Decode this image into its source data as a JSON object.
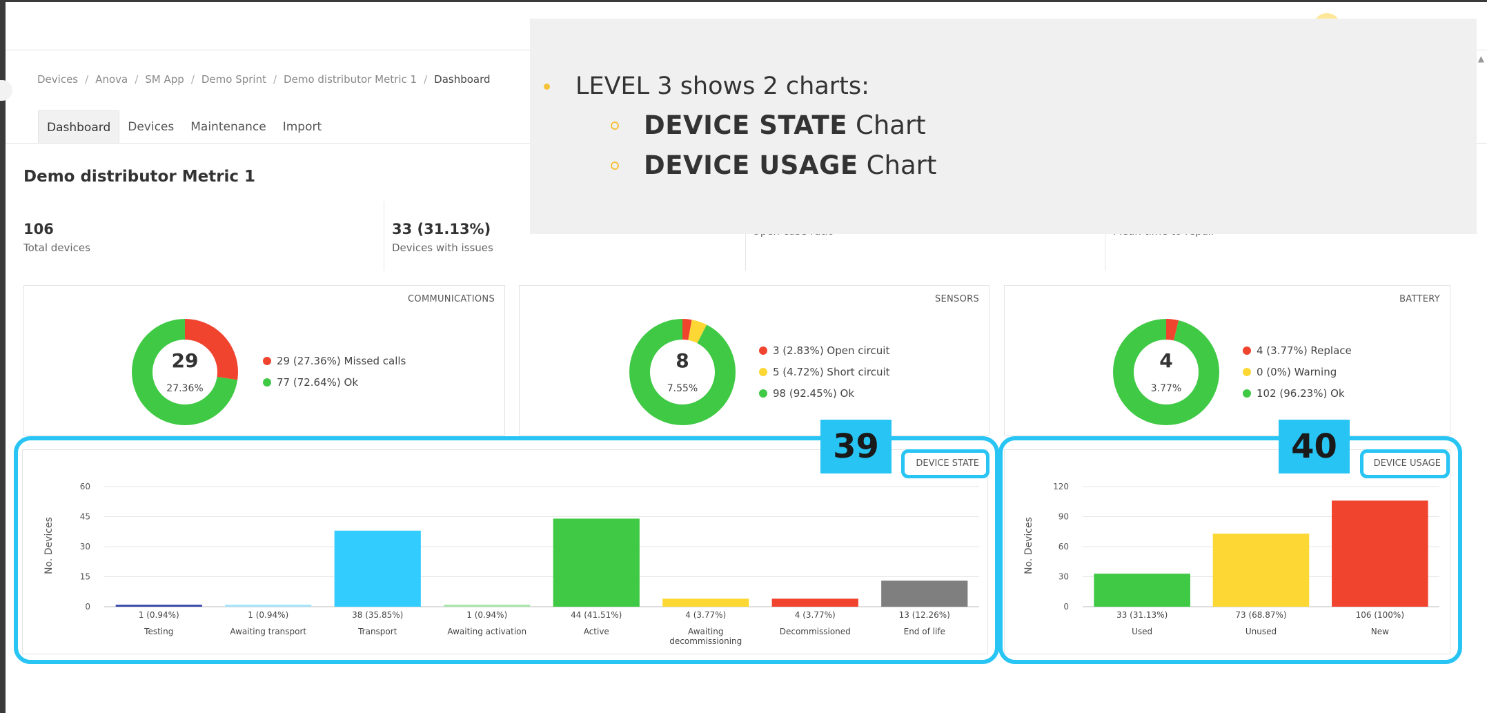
{
  "breadcrumb": [
    "Devices",
    "Anova",
    "SM App",
    "Demo Sprint",
    "Demo distributor Metric 1",
    "Dashboard"
  ],
  "tabs": [
    "Dashboard",
    "Devices",
    "Maintenance",
    "Import"
  ],
  "page_title": "Demo distributor Metric 1",
  "kpis": [
    {
      "value": "106",
      "label": "Total devices"
    },
    {
      "value": "33 (31.13%)",
      "label": "Devices with issues"
    },
    {
      "value": "",
      "label": "Open case ratio"
    },
    {
      "value": "",
      "label": "Mean time to repair"
    }
  ],
  "colors": {
    "red": "#f0442f",
    "green": "#3fc944",
    "yellow": "#fdd835",
    "blue": "#33ccff",
    "highlight": "#27c4f4"
  },
  "donuts": [
    {
      "title": "COMMUNICATIONS",
      "center_value": "29",
      "center_percent": "27.36%",
      "legend": [
        {
          "text": "29 (27.36%) Missed calls",
          "color": "#f0442f",
          "value": 29
        },
        {
          "text": "77 (72.64%) Ok",
          "color": "#3fc944",
          "value": 77
        }
      ]
    },
    {
      "title": "SENSORS",
      "center_value": "8",
      "center_percent": "7.55%",
      "legend": [
        {
          "text": "3 (2.83%) Open circuit",
          "color": "#f0442f",
          "value": 3
        },
        {
          "text": "5 (4.72%) Short circuit",
          "color": "#fdd835",
          "value": 5
        },
        {
          "text": "98 (92.45%) Ok",
          "color": "#3fc944",
          "value": 98
        }
      ]
    },
    {
      "title": "BATTERY",
      "center_value": "4",
      "center_percent": "3.77%",
      "legend": [
        {
          "text": "4 (3.77%) Replace",
          "color": "#f0442f",
          "value": 4
        },
        {
          "text": "0 (0%) Warning",
          "color": "#fdd835",
          "value": 0
        },
        {
          "text": "102 (96.23%) Ok",
          "color": "#3fc944",
          "value": 102
        }
      ]
    }
  ],
  "chart_data": [
    {
      "type": "bar",
      "title": "DEVICE STATE",
      "ylabel": "No. Devices",
      "ylim": [
        0,
        60
      ],
      "yticks": [
        0,
        15,
        30,
        45,
        60
      ],
      "grid": true,
      "categories": [
        "Testing",
        "Awaiting transport",
        "Transport",
        "Awaiting activation",
        "Active",
        "Awaiting decommissioning",
        "Decommissioned",
        "End of life"
      ],
      "values": [
        1,
        1,
        38,
        1,
        44,
        4,
        4,
        13
      ],
      "data_labels": [
        "1 (0.94%)",
        "1 (0.94%)",
        "38 (35.85%)",
        "1 (0.94%)",
        "44 (41.51%)",
        "4 (3.77%)",
        "4 (3.77%)",
        "13 (12.26%)"
      ],
      "colors": [
        "#3949ab",
        "#a4e4fb",
        "#33ccff",
        "#a8e6aa",
        "#3fc944",
        "#fdd835",
        "#f0442f",
        "#7f7f7f"
      ]
    },
    {
      "type": "bar",
      "title": "DEVICE USAGE",
      "ylabel": "No. Devices",
      "ylim": [
        0,
        120
      ],
      "yticks": [
        0,
        30,
        60,
        90,
        120
      ],
      "grid": true,
      "categories": [
        "Used",
        "Unused",
        "New"
      ],
      "values": [
        33,
        73,
        106
      ],
      "data_labels": [
        "33 (31.13%)",
        "73 (68.87%)",
        "106 (100%)"
      ],
      "colors": [
        "#3fc944",
        "#fdd835",
        "#f0442f"
      ]
    }
  ],
  "badges": [
    "39",
    "40"
  ],
  "overlay": {
    "line1": "LEVEL 3 shows 2 charts:",
    "items": [
      {
        "bold": "DEVICE STATE",
        "rest": "Chart"
      },
      {
        "bold": "DEVICE USAGE",
        "rest": "Chart"
      }
    ]
  }
}
